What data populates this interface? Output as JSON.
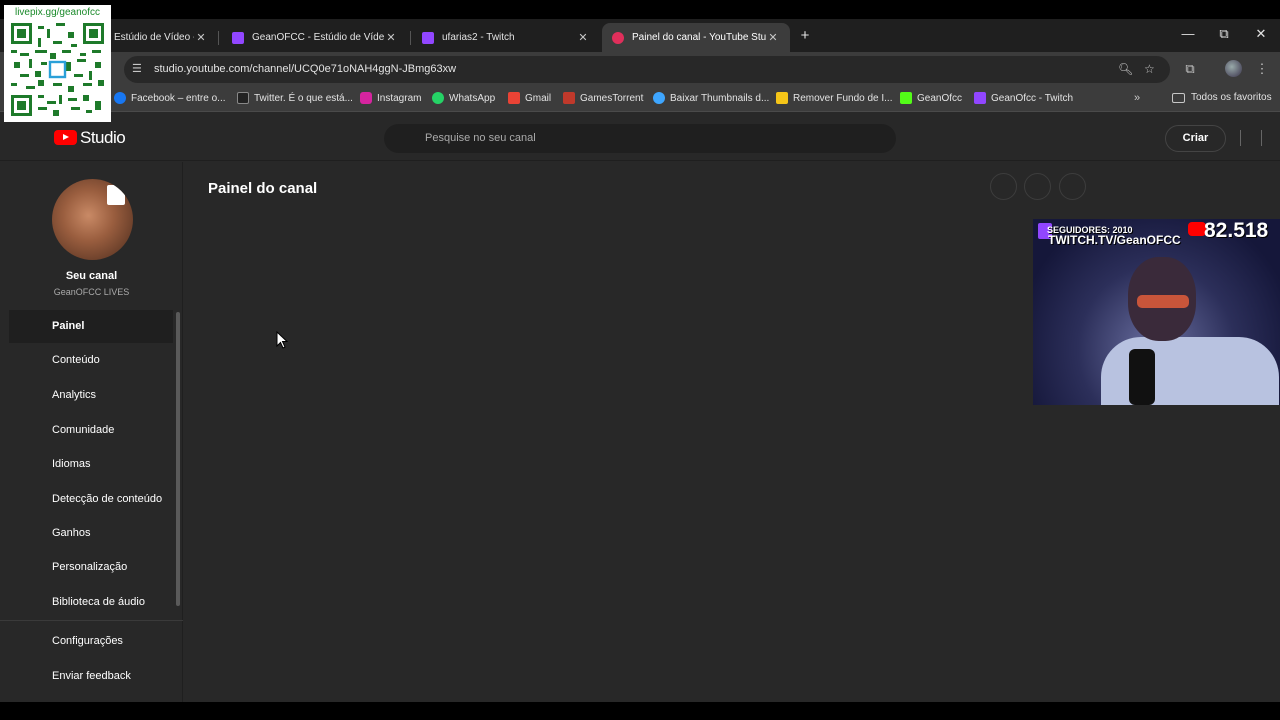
{
  "overlay": {
    "qr_label": "livepix.gg/geanofcc"
  },
  "browser": {
    "tabs": [
      {
        "title": "Estúdio de Vídeo -",
        "favicon_color": "#e02f5b",
        "active": false
      },
      {
        "title": "GeanOFCC - Estúdio de Vídeo -",
        "favicon_color": "#9146ff",
        "active": false
      },
      {
        "title": "ufarias2 - Twitch",
        "favicon_color": "#9146ff",
        "active": false
      },
      {
        "title": "Painel do canal - YouTube Studio",
        "favicon_color": "#e02f5b",
        "active": true
      }
    ],
    "new_tab": "+",
    "window_controls": {
      "minimize": "—",
      "restore": "⧉",
      "close": "✕"
    },
    "url": "studio.youtube.com/channel/UCQ0e71oNAH4ggN-JBmg63xw",
    "bookmarks": [
      {
        "label": "Facebook – entre o...",
        "icon_color": "#1877f2"
      },
      {
        "label": "Twitter. É o que está...",
        "icon_color": "#222222"
      },
      {
        "label": "Instagram",
        "icon_color": "#d6249f"
      },
      {
        "label": "WhatsApp",
        "icon_color": "#25d366"
      },
      {
        "label": "Gmail",
        "icon_color": "#ea4335"
      },
      {
        "label": "GamesTorrent",
        "icon_color": "#c0392b"
      },
      {
        "label": "Baixar Thumbnails d...",
        "icon_color": "#3ea6ff"
      },
      {
        "label": "Remover Fundo de I...",
        "icon_color": "#f5c518"
      },
      {
        "label": "GeanOfcc",
        "icon_color": "#53fc18"
      },
      {
        "label": "GeanOfcc - Twitch",
        "icon_color": "#9146ff"
      }
    ],
    "bookmarks_more": "»",
    "all_bookmarks": "Todos os favoritos"
  },
  "studio": {
    "logo_text": "Studio",
    "search_placeholder": "Pesquise no seu canal",
    "create_label": "Criar",
    "channel": {
      "title": "Seu canal",
      "name": "GeanOFCC LIVES"
    },
    "nav": [
      {
        "label": "Painel",
        "active": true
      },
      {
        "label": "Conteúdo",
        "active": false
      },
      {
        "label": "Analytics",
        "active": false
      },
      {
        "label": "Comunidade",
        "active": false
      },
      {
        "label": "Idiomas",
        "active": false
      },
      {
        "label": "Detecção de conteúdo",
        "active": false
      },
      {
        "label": "Ganhos",
        "active": false
      },
      {
        "label": "Personalização",
        "active": false
      },
      {
        "label": "Biblioteca de áudio",
        "active": false
      }
    ],
    "nav_bottom": [
      {
        "label": "Configurações"
      },
      {
        "label": "Enviar feedback"
      }
    ],
    "page_title": "Painel do canal"
  },
  "webcam": {
    "followers_text": "SEGUIDORES: 2010",
    "twitch_text": "TWITCH.TV/GeanOFCC",
    "subscriber_count": "82.518"
  }
}
